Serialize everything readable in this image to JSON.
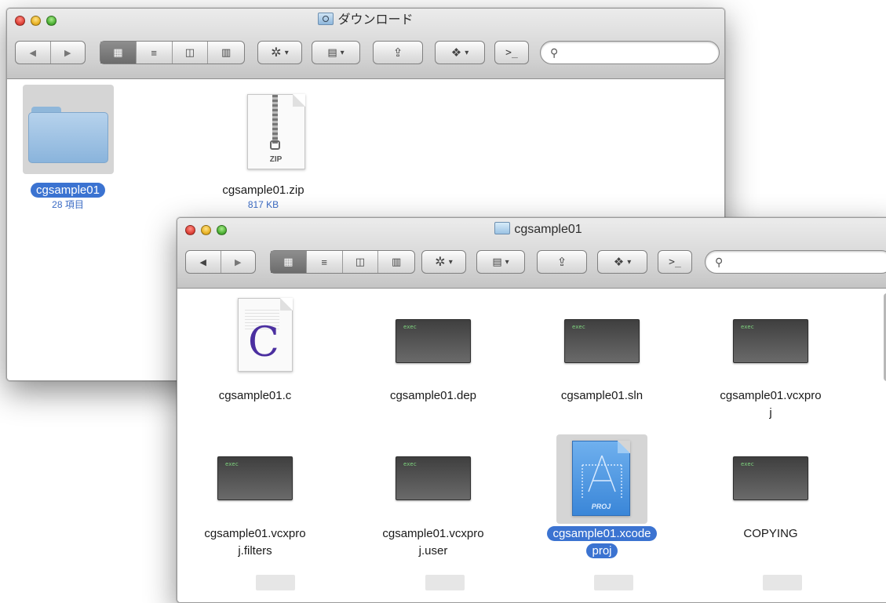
{
  "window_back": {
    "title": "ダウンロード",
    "items": [
      {
        "name": "cgsample01",
        "sub": "28 項目",
        "kind": "folder"
      },
      {
        "name": "cgsample01.zip",
        "sub": "817 KB",
        "kind": "zip",
        "badge": "ZIP"
      }
    ],
    "search_placeholder": ""
  },
  "window_front": {
    "title": "cgsample01",
    "items": [
      {
        "name": "cgsample01.c",
        "kind": "c-source",
        "badge": "C"
      },
      {
        "name": "cgsample01.dep",
        "kind": "exec",
        "badge": "exec"
      },
      {
        "name": "cgsample01.sln",
        "kind": "exec",
        "badge": "exec"
      },
      {
        "name": "cgsample01.vcxproj",
        "line1": "cgsample01.vcxpro",
        "line2": "j",
        "kind": "exec",
        "badge": "exec"
      },
      {
        "name": "cgsample01.vcxproj.filters",
        "line1": "cgsample01.vcxpro",
        "line2": "j.filters",
        "kind": "exec",
        "badge": "exec"
      },
      {
        "name": "cgsample01.vcxproj.user",
        "line1": "cgsample01.vcxpro",
        "line2": "j.user",
        "kind": "exec",
        "badge": "exec"
      },
      {
        "name": "cgsample01.xcodeproj",
        "line1": "cgsample01.xcode",
        "line2": "proj",
        "kind": "xcodeproj",
        "badge": "PROJ",
        "selected": true
      },
      {
        "name": "COPYING",
        "kind": "exec",
        "badge": "exec"
      }
    ],
    "search_placeholder": ""
  },
  "toolbar": {
    "back_icon": "◀",
    "forward_icon": "▶",
    "view_icon": "▦",
    "list_icon": "≡",
    "column_icon": "◫",
    "coverflow_icon": "▥",
    "action_icon": "✲",
    "arrange_icon": "▤",
    "share_icon": "⇪",
    "dropbox_icon": "❖",
    "terminal_icon": ">_",
    "dropdown_icon": "▾",
    "search_icon": "⚲"
  }
}
